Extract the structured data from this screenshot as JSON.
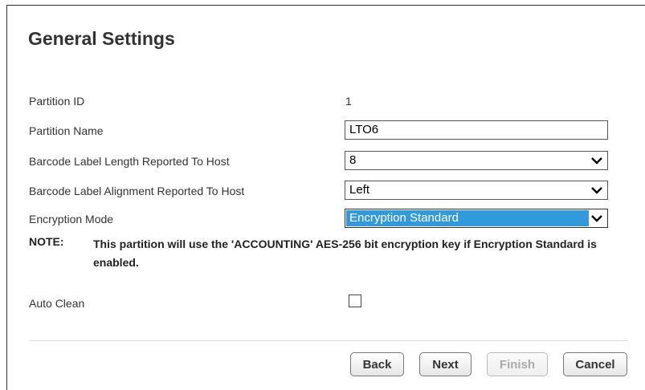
{
  "title": "General Settings",
  "fields": {
    "partition_id": {
      "label": "Partition ID",
      "value": "1"
    },
    "partition_name": {
      "label": "Partition Name",
      "value": "LTO6"
    },
    "barcode_length": {
      "label": "Barcode Label Length Reported To Host",
      "value": "8"
    },
    "barcode_alignment": {
      "label": "Barcode Label Alignment Reported To Host",
      "value": "Left"
    },
    "encryption_mode": {
      "label": "Encryption Mode",
      "value": "Encryption Standard"
    },
    "auto_clean": {
      "label": "Auto Clean",
      "checked": false
    }
  },
  "note": {
    "label": "NOTE:",
    "text": "This partition will use the 'ACCOUNTING' AES-256 bit encryption key if Encryption Standard is enabled."
  },
  "buttons": {
    "back": "Back",
    "next": "Next",
    "finish": "Finish",
    "cancel": "Cancel"
  },
  "colors": {
    "selection": "#3399dd",
    "text": "#333333"
  },
  "icons": {
    "dropdown": "chevron-down-icon"
  }
}
